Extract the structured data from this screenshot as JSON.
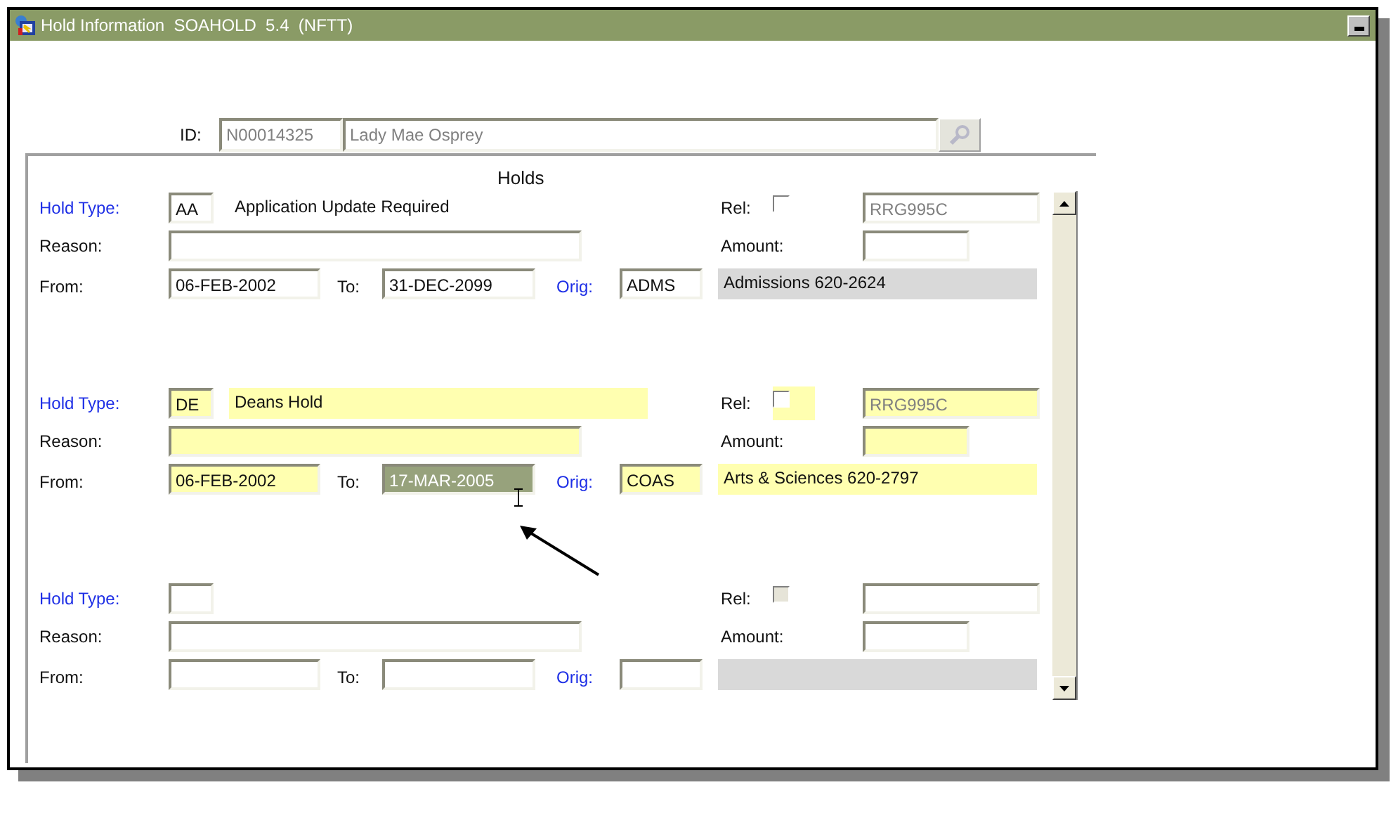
{
  "window": {
    "title": "Hold Information  SOAHOLD  5.4  (NFTT)"
  },
  "id_row": {
    "label": "ID:",
    "id": "N00014325",
    "name": "Lady Mae Osprey"
  },
  "block": {
    "title": "Holds",
    "records": [
      {
        "current": false,
        "hold_type": {
          "label": "Hold Type:",
          "code": "AA",
          "description": "Application Update Required"
        },
        "rel": {
          "label": "Rel:",
          "checked": false,
          "disabled": false
        },
        "user": "RRG995C",
        "reason": {
          "label": "Reason:"
        },
        "amount": {
          "label": "Amount:"
        },
        "from": {
          "label": "From:",
          "value": "06-FEB-2002"
        },
        "to": {
          "label": "To:",
          "value": "31-DEC-2099",
          "selected": false
        },
        "orig": {
          "label": "Orig:",
          "code": "ADMS",
          "description": "Admissions 620-2624"
        }
      },
      {
        "current": true,
        "hold_type": {
          "label": "Hold Type:",
          "code": "DE",
          "description": "Deans Hold"
        },
        "rel": {
          "label": "Rel:",
          "checked": false,
          "disabled": false
        },
        "user": "RRG995C",
        "reason": {
          "label": "Reason:"
        },
        "amount": {
          "label": "Amount:"
        },
        "from": {
          "label": "From:",
          "value": "06-FEB-2002"
        },
        "to": {
          "label": "To:",
          "value": "17-MAR-2005",
          "selected": true
        },
        "orig": {
          "label": "Orig:",
          "code": "COAS",
          "description": "Arts & Sciences 620-2797"
        }
      },
      {
        "current": false,
        "hold_type": {
          "label": "Hold Type:"
        },
        "rel": {
          "label": "Rel:",
          "checked": false,
          "disabled": true
        },
        "reason": {
          "label": "Reason:"
        },
        "amount": {
          "label": "Amount:"
        },
        "from": {
          "label": "From:"
        },
        "to": {
          "label": "To:",
          "selected": false
        },
        "orig": {
          "label": "Orig:"
        }
      }
    ]
  }
}
